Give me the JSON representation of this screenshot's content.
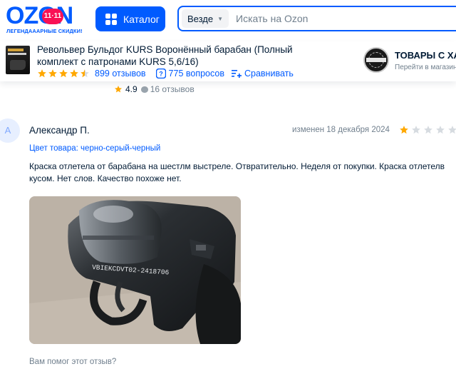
{
  "header": {
    "logo_text": "OZON",
    "logo_badge": "11·11",
    "logo_subtitle": "ЛЕГЕНДАААРНЫЕ СКИДКИ!",
    "catalog_label": "Каталог",
    "search_scope": "Везде",
    "search_placeholder": "Искать на Ozon"
  },
  "product_bar": {
    "title": "Револьвер Бульдог KURS Воронённый барабан (Полный комплект с патронами KURS 5,6/16)",
    "rating_stars": 4.5,
    "reviews_count": "899 отзывов",
    "questions_count": "775 вопросов",
    "compare_label": "Сравнивать",
    "seller_name": "ТОВАРЫ С ХАР",
    "seller_link": "Перейти в магазин"
  },
  "previous_review": {
    "rating": "4.9",
    "reviews": "16 отзывов"
  },
  "review": {
    "avatar_letter": "А",
    "author": "Александр П.",
    "edited": "изменен 18 декабря 2024",
    "stars": 1,
    "stars_max": 5,
    "variant": "Цвет товара: черно-серый-черный",
    "text": "Краска отлетела от барабана на шестлм выстреле. Отвратительно. Неделя от покупки. Краска отлетелв кусом. Нет слов. Качество похоже нет.",
    "photo_engraving": "VBIEKCDVT02-2418706",
    "helpful_question": "Вам помог этот отзыв?"
  },
  "colors": {
    "brand_blue": "#005bff",
    "star_gold": "#ffa800",
    "star_empty": "#d6dbe0",
    "logo_badge": "#f91155",
    "text_primary": "#001a34",
    "text_secondary": "#707f8d"
  }
}
